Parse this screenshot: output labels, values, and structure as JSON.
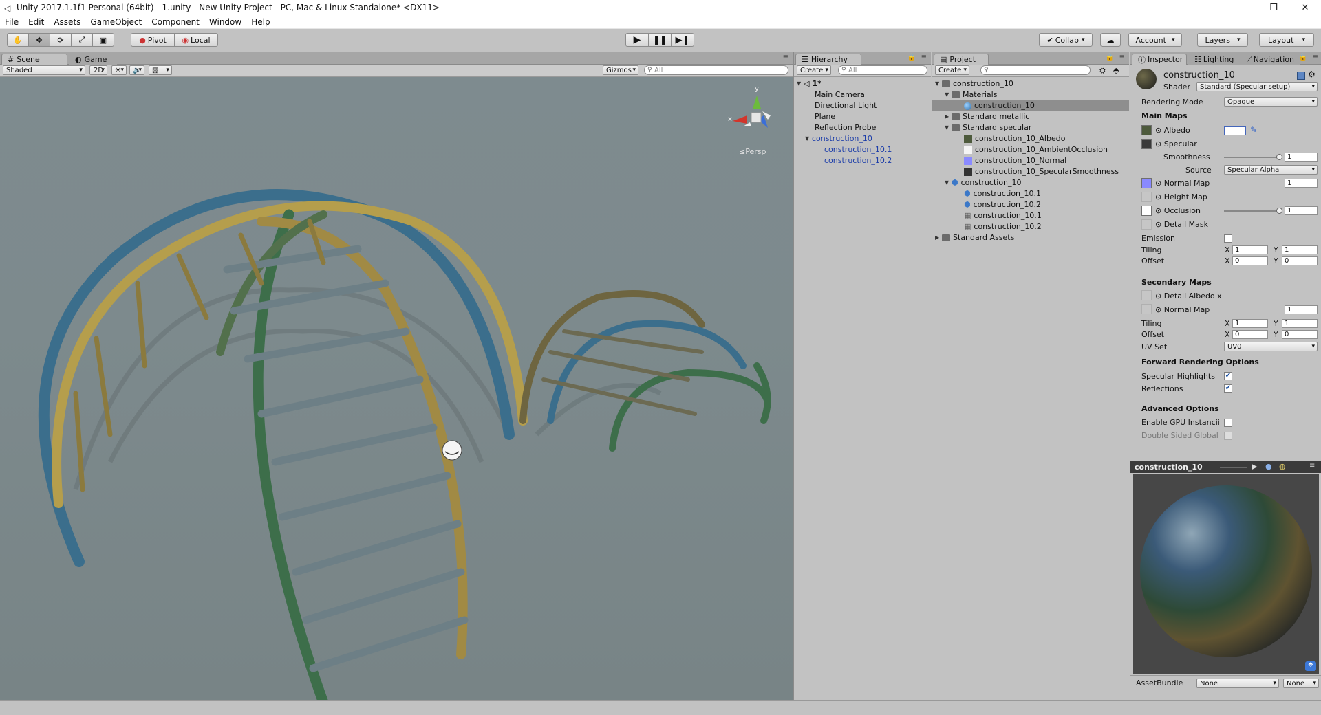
{
  "window": {
    "title": "Unity 2017.1.1f1 Personal (64bit) - 1.unity - New Unity Project - PC, Mac & Linux Standalone* <DX11>",
    "controls": [
      "—",
      "❐",
      "✕"
    ]
  },
  "menu": [
    "File",
    "Edit",
    "Assets",
    "GameObject",
    "Component",
    "Window",
    "Help"
  ],
  "toolbar": {
    "pivot": "Pivot",
    "local": "Local",
    "collab": "Collab",
    "account": "Account",
    "layers": "Layers",
    "layout": "Layout"
  },
  "scene": {
    "tab_scene": "Scene",
    "tab_game": "Game",
    "shading": "Shaded",
    "mode_2d": "2D",
    "gizmos": "Gizmos",
    "search_placeholder": "All",
    "persp_label": "Persp",
    "gizmo_y": "y",
    "gizmo_x": "x"
  },
  "hierarchy": {
    "tab": "Hierarchy",
    "create": "Create",
    "search_placeholder": "All",
    "scene_name": "1*",
    "items": [
      "Main Camera",
      "Directional Light",
      "Plane",
      "Reflection Probe",
      "construction_10",
      "construction_10.1",
      "construction_10.2"
    ]
  },
  "project": {
    "tab": "Project",
    "create": "Create",
    "root": "construction_10",
    "materials": "Materials",
    "material_selected": "construction_10",
    "standard_metallic": "Standard metallic",
    "standard_specular": "Standard specular",
    "textures": [
      "construction_10_Albedo",
      "construction_10_AmbientOcclusion",
      "construction_10_Normal",
      "construction_10_SpecularSmoothness"
    ],
    "model": "construction_10",
    "model_children": [
      "construction_10.1",
      "construction_10.2",
      "construction_10.1",
      "construction_10.2"
    ],
    "standard_assets": "Standard Assets"
  },
  "inspector": {
    "tab_inspector": "Inspector",
    "tab_lighting": "Lighting",
    "tab_navigation": "Navigation",
    "material_name": "construction_10",
    "shader_label": "Shader",
    "shader_value": "Standard (Specular setup)",
    "rendering_mode_label": "Rendering Mode",
    "rendering_mode_value": "Opaque",
    "main_maps": "Main Maps",
    "albedo": "Albedo",
    "specular": "Specular",
    "smoothness": "Smoothness",
    "smoothness_value": "1",
    "smoothness_level": 1.0,
    "source_label": "Source",
    "source_value": "Specular Alpha",
    "normal_map": "Normal Map",
    "normal_value": "1",
    "height_map": "Height Map",
    "occlusion": "Occlusion",
    "occlusion_value": "1",
    "occlusion_level": 1.0,
    "detail_mask": "Detail Mask",
    "emission": "Emission",
    "tiling": "Tiling",
    "offset": "Offset",
    "x": "X",
    "y": "Y",
    "tiling_x": "1",
    "tiling_y": "1",
    "offset_x": "0",
    "offset_y": "0",
    "secondary_maps": "Secondary Maps",
    "detail_albedo": "Detail Albedo x",
    "sec_normal_map": "Normal Map",
    "sec_normal_value": "1",
    "sec_tiling_x": "1",
    "sec_tiling_y": "1",
    "sec_offset_x": "0",
    "sec_offset_y": "0",
    "uv_set_label": "UV Set",
    "uv_set_value": "UV0",
    "forward_rendering": "Forward Rendering Options",
    "specular_highlights": "Specular Highlights",
    "reflections": "Reflections",
    "check_mark": "✔",
    "advanced_options": "Advanced Options",
    "gpu_instancing": "Enable GPU Instancii",
    "double_sided": "Double Sided Global",
    "preview_title": "construction_10",
    "assetbundle_label": "AssetBundle",
    "assetbundle_value": "None",
    "assetbundle_variant": "None"
  },
  "colors": {
    "albedo_swatch": "#ffffff",
    "normal_swatch": "#8a8aff",
    "selection": "#8e8e8e",
    "link_blue": "#1c3da9"
  }
}
